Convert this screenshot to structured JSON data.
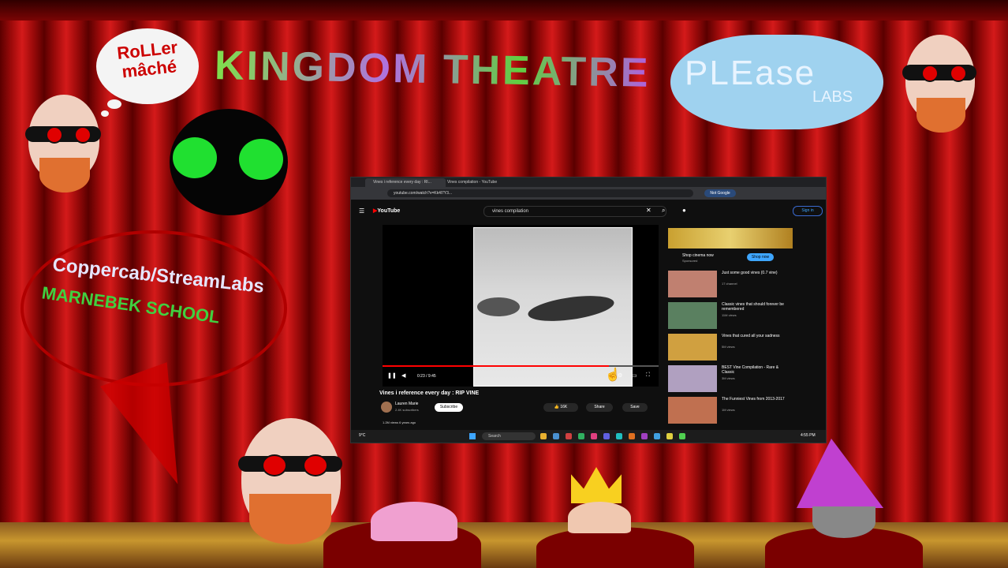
{
  "stage": {
    "title": "KINGDOM THEATRE",
    "roller_line1": "RoLLer",
    "roller_line2": "mâché",
    "please": "PLEase",
    "labs": "LABS",
    "bubble_line1": "Coppercab/StreamLabs",
    "bubble_line2": "MARNEBEK SCHOOL"
  },
  "browser": {
    "tabs": [
      {
        "label": "Vines i reference every day : RI..."
      },
      {
        "label": "Vines compilation - YouTube"
      }
    ],
    "url": "youtube.com/watch?v=Kk4l7Y3...",
    "search_query": "vines compilation",
    "signin_label": "Sign in",
    "profile_label": "Not Google",
    "logo_label": "YouTube",
    "video": {
      "title": "Vines i reference every day : RIP VINE",
      "channel": "Lauren Marie",
      "subscribers": "2.4K subscribers",
      "subscribe_label": "Subscribe",
      "likes": "16K",
      "share_label": "Share",
      "save_label": "Save",
      "time": "0:23 / 9:45",
      "progress_fraction": 0.82,
      "views": "1.2M views  6 years ago"
    },
    "ad": {
      "title": "Shop cinema now",
      "sponsor": "Sponsored",
      "button": "Shop now"
    },
    "recommendations": [
      {
        "title": "Just some good vines (0.7 vine)",
        "meta": "17 channel"
      },
      {
        "title": "Classic vines that should forever be remembered",
        "meta": "11M views"
      },
      {
        "title": "Vines that cured all your sadness",
        "meta": "5M views"
      },
      {
        "title": "BEST Vine Compilation - Rare & Classic",
        "meta": "3M views"
      },
      {
        "title": "The Funniest Vines from 2013-2017",
        "meta": "1M views"
      }
    ],
    "taskbar_search": "Search",
    "weather": "9°C",
    "clock": "4:55 PM"
  },
  "colors": {
    "curtain": "#c01414",
    "accent_red": "#ff0000",
    "spider_eyes": "#20e030"
  }
}
